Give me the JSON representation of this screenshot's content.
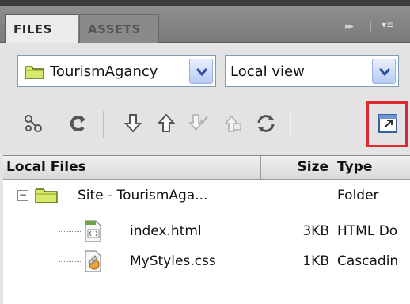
{
  "tabs": [
    {
      "label": "FILES",
      "active": true
    },
    {
      "label": "ASSETS",
      "active": false
    }
  ],
  "tab_controls": {
    "expand": "▸▸",
    "separator": "|",
    "menu": "▾≡"
  },
  "site_select": {
    "value": "TourismAgancy",
    "icon": "folder-icon"
  },
  "view_select": {
    "value": "Local view"
  },
  "toolbar": [
    {
      "name": "connect-button",
      "icon": "connect-icon"
    },
    {
      "name": "refresh-button",
      "icon": "refresh-icon"
    },
    {
      "name": "get-files-button",
      "icon": "down-arrow-icon"
    },
    {
      "name": "put-files-button",
      "icon": "up-arrow-icon"
    },
    {
      "name": "check-out-button",
      "icon": "check-out-icon",
      "disabled": true
    },
    {
      "name": "check-in-button",
      "icon": "check-in-icon",
      "disabled": true
    },
    {
      "name": "synchronize-button",
      "icon": "sync-icon"
    },
    {
      "name": "expand-view-button",
      "icon": "expand-icon",
      "highlighted": true
    }
  ],
  "table": {
    "headers": {
      "name": "Local Files",
      "size": "Size",
      "type": "Type"
    },
    "rows": [
      {
        "name": "Site - TourismAga...",
        "size": "",
        "type": "Folder",
        "icon": "folder-icon",
        "level": 0
      },
      {
        "name": "index.html",
        "size": "3KB",
        "type": "HTML Do",
        "icon": "html-file-icon",
        "level": 1
      },
      {
        "name": "MyStyles.css",
        "size": "1KB",
        "type": "Cascadin",
        "icon": "css-file-icon",
        "level": 1
      }
    ]
  },
  "colors": {
    "highlight": "#e0282e",
    "tabbar": "#848484",
    "panel": "#e3e3e3"
  }
}
